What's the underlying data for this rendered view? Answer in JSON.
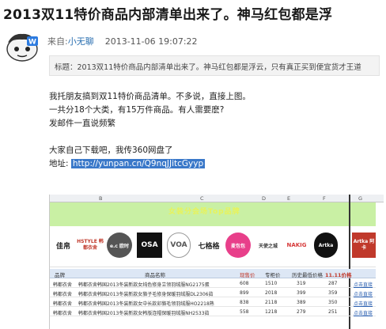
{
  "post": {
    "headline": "2013双11特价商品内部清单出来了。神马红包都是浮",
    "from_label": "来自:",
    "author": "小无聊",
    "timestamp": "2013-11-06 19:07:22",
    "title_line": "标题：2013双11特价商品内部清单出来了。神马红包都是浮云，只有真正买到便宜货才王道",
    "paragraph_1": "我托朋友搞到双11特价商品清单。不多说，直接上图。",
    "paragraph_2": "一共分18个大类，有15万件商品。有人需要麽?",
    "paragraph_3": "发邮件一直说频繁",
    "paragraph_4": "大家自己下载吧，我传360网盘了",
    "address_label": "地址:",
    "url": "http://yunpan.cn/Q9nqJJitcGyyp"
  },
  "spreadsheet": {
    "col_headers": [
      "B",
      "C",
      "D",
      "E",
      "F",
      "G"
    ],
    "banner_title": "女装分会场Top品牌",
    "brand_logos": [
      {
        "name": "佳帛",
        "color": "#222222",
        "bg": "#ffffff"
      },
      {
        "name": "HSTYLE 韩都衣舍",
        "color": "#c0392b",
        "bg": "#ffffff"
      },
      {
        "name": "e.c 欧时",
        "color": "#ffffff",
        "bg": "#555555"
      },
      {
        "name": "OSA",
        "color": "#ffffff",
        "bg": "#111111"
      },
      {
        "name": "VOA",
        "color": "#555555",
        "bg": "#ffffff"
      },
      {
        "name": "七格格",
        "color": "#222222",
        "bg": "#ffffff"
      },
      {
        "name": "麦包包",
        "color": "#ffffff",
        "bg": "#e83f8a"
      },
      {
        "name": "天使之城",
        "color": "#333333",
        "bg": "#ffffff"
      },
      {
        "name": "NAKIG",
        "color": "#d63a3a",
        "bg": "#ffffff"
      },
      {
        "name": "Artka",
        "color": "#ffffff",
        "bg": "#111111"
      },
      {
        "name": "Artka 阿卡",
        "color": "#ffffff",
        "bg": "#c0392b"
      }
    ],
    "table_headers": [
      "品牌",
      "商品名称",
      "现售价",
      "专柜价",
      "历史最低价格",
      "11.11价格"
    ],
    "rows": [
      {
        "brand": "韩都衣舍",
        "name": "韩都衣舍韩国2013冬装新款女纯色修身立领羽绒服NG2175蛋",
        "price": "608",
        "list": "1510",
        "low": "319",
        "deal": "287",
        "link": "点击直接"
      },
      {
        "brand": "韩都衣舍",
        "name": "韩都衣舍韩国2013冬装新款女貉子毛修身保暖羽绒服DL2306茹",
        "price": "899",
        "list": "2018",
        "low": "399",
        "deal": "359",
        "link": "点击直接"
      },
      {
        "brand": "韩都衣舍",
        "name": "韩都衣舍韩国2013冬装新款女中长款卯貉毛领羽绒服HO2218熟",
        "price": "838",
        "list": "2118",
        "low": "389",
        "deal": "350",
        "link": "点击直接"
      },
      {
        "brand": "韩都衣舍",
        "name": "韩都衣舍韩国2013冬装新款女韩版连帽保暖羽绒服NH2533茹",
        "price": "558",
        "list": "1218",
        "low": "279",
        "deal": "251",
        "link": "点击直接"
      }
    ]
  }
}
